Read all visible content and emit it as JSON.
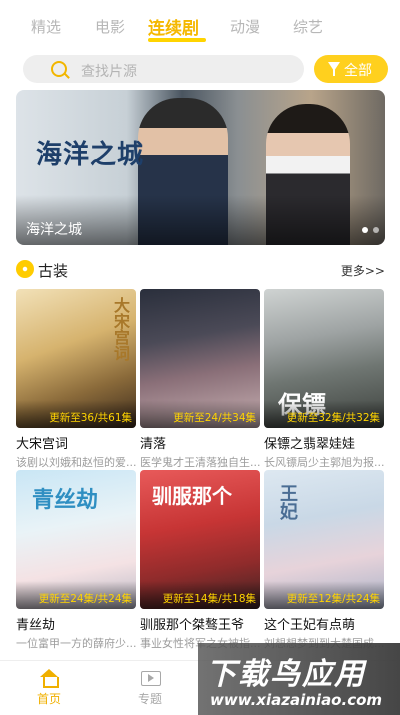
{
  "tabs": [
    {
      "label": "精选"
    },
    {
      "label": "电影"
    },
    {
      "label": "连续剧"
    },
    {
      "label": "动漫"
    },
    {
      "label": "综艺"
    }
  ],
  "active_tab": "连续剧",
  "search": {
    "placeholder": "查找片源"
  },
  "filter": {
    "label": "全部"
  },
  "banner": {
    "title": "海洋之城",
    "poster_title": "海洋之城",
    "dots": 2
  },
  "section": {
    "title": "古装",
    "more": "更多>>"
  },
  "cards": [
    {
      "title": "大宋宫词",
      "desc": "该剧以刘娥和赵恒的爱...",
      "status": "更新至36/共61集",
      "poster_word": "大宋宫词"
    },
    {
      "title": "清落",
      "desc": "医学鬼才王清落独自生...",
      "status": "更新至24/共34集",
      "poster_word": ""
    },
    {
      "title": "保镖之翡翠娃娃",
      "desc": "长风镖局少主郭旭为报...",
      "status": "更新至32集/共32集",
      "poster_word": "保镖"
    },
    {
      "title": "青丝劫",
      "desc": "一位富甲一方的薛府少...",
      "status": "更新至24集/共24集",
      "poster_word": "青丝劫"
    },
    {
      "title": "驯服那个桀骜王爷",
      "desc": "事业女性将军之女被指...",
      "status": "更新至14集/共18集",
      "poster_word": "驯服那个"
    },
    {
      "title": "这个王妃有点萌",
      "desc": "刘想想梦到到大楚国成...",
      "status": "更新至12集/共24集",
      "poster_word": "王妃"
    }
  ],
  "bottom_nav": [
    {
      "label": "首页",
      "active": true
    },
    {
      "label": "专题",
      "active": false
    }
  ],
  "watermark": {
    "main": "下载鸟应用",
    "sub": "www.xiazainiao.com"
  },
  "colors": {
    "accent": "#ffd01e",
    "active_text": "#f5b800",
    "status": "#ffd400"
  }
}
